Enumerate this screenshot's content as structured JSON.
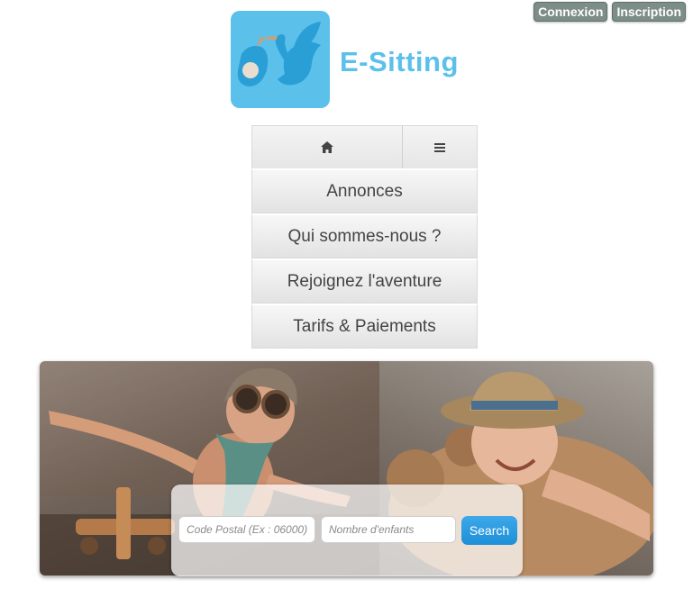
{
  "header": {
    "login_label": "Connexion",
    "register_label": "Inscription",
    "brand_name": "E-Sitting",
    "brand_color": "#5bc0ea"
  },
  "nav": {
    "home_icon": "home-icon",
    "menu_icon": "hamburger-icon",
    "items": [
      {
        "label": "Annonces"
      },
      {
        "label": "Qui sommes-nous ?"
      },
      {
        "label": "Rejoignez l'aventure"
      },
      {
        "label": "Tarifs & Paiements"
      }
    ]
  },
  "hero": {
    "left_image": "child-aviator-photo",
    "right_image": "child-teddy-bear-photo"
  },
  "search": {
    "postal_placeholder": "Code Postal (Ex : 06000)",
    "children_placeholder": "Nombre d'enfants",
    "button_label": "Search",
    "button_color": "#2196e3"
  }
}
